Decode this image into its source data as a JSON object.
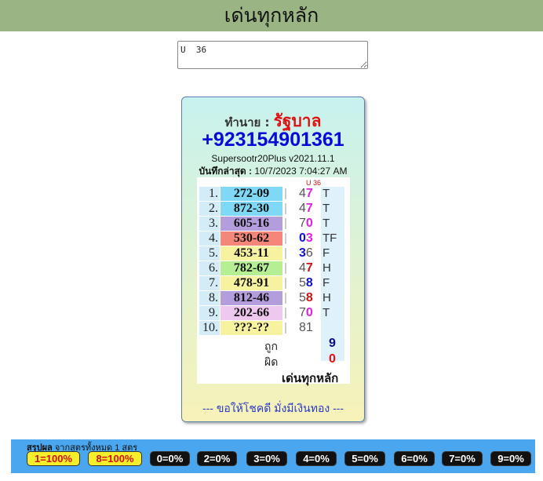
{
  "header": {
    "title": "เด่นทุกหลัก"
  },
  "input": {
    "value": "U  36"
  },
  "card": {
    "owner_label": "ทำนาย :",
    "owner_name": "รัฐบาล",
    "phone": "+923154901361",
    "version": "Supersootr20Plus v2021.11.1",
    "saved_label": "บันทึกล่าสุด :",
    "saved_value": "10/7/2023 7:04:27 AM",
    "column_header": "U 36",
    "rows": [
      {
        "num": "1.",
        "code": "272-09",
        "r1": "4",
        "r2": "7",
        "flag": "T",
        "code_bg": "#7fd8f6",
        "r1_color": "#555555",
        "r2_color": "#e020e0"
      },
      {
        "num": "2.",
        "code": "872-30",
        "r1": "4",
        "r2": "7",
        "flag": "T",
        "code_bg": "#7fd8f6",
        "r1_color": "#555555",
        "r2_color": "#e020e0"
      },
      {
        "num": "3.",
        "code": "605-16",
        "r1": "7",
        "r2": "0",
        "flag": "T",
        "code_bg": "#b39ddc",
        "r1_color": "#555555",
        "r2_color": "#e020e0"
      },
      {
        "num": "4.",
        "code": "530-62",
        "r1": "0",
        "r2": "3",
        "flag": "TF",
        "code_bg": "#f4877a",
        "r1_color": "#1010d0",
        "r2_color": "#e020e0"
      },
      {
        "num": "5.",
        "code": "453-11",
        "r1": "3",
        "r2": "6",
        "flag": "F",
        "code_bg": "#f7f2a0",
        "r1_color": "#1010d0",
        "r2_color": "#555555"
      },
      {
        "num": "6.",
        "code": "782-67",
        "r1": "4",
        "r2": "7",
        "flag": "H",
        "code_bg": "#b6ee94",
        "r1_color": "#555555",
        "r2_color": "#d01010"
      },
      {
        "num": "7.",
        "code": "478-91",
        "r1": "5",
        "r2": "8",
        "flag": "F",
        "code_bg": "#f7f2a0",
        "r1_color": "#555555",
        "r2_color": "#1010d0"
      },
      {
        "num": "8.",
        "code": "812-46",
        "r1": "5",
        "r2": "8",
        "flag": "H",
        "code_bg": "#b39ddc",
        "r1_color": "#555555",
        "r2_color": "#d01010"
      },
      {
        "num": "9.",
        "code": "202-66",
        "r1": "7",
        "r2": "0",
        "flag": "T",
        "code_bg": "#eec8ee",
        "r1_color": "#555555",
        "r2_color": "#e020e0"
      },
      {
        "num": "10.",
        "code": "???-??",
        "r1": "8",
        "r2": "1",
        "flag": "",
        "code_bg": "#f7f2a0",
        "r1_color": "#555555",
        "r2_color": "#555555"
      }
    ],
    "correct_label": "ถูก",
    "correct_value": "9",
    "wrong_label": "ผิด",
    "wrong_value": "0",
    "mode_label": "เด่นทุกหลัก",
    "blessing": "--- ขอให้โชคดี มั่งมีเงินทอง ---"
  },
  "footer": {
    "summary_label": "สรุปผล",
    "summary_text": "จากสูตรทั้งหมด 1 สูตร",
    "badges": [
      {
        "text": "1=100%",
        "state": "hit"
      },
      {
        "text": "8=100%",
        "state": "hit"
      },
      {
        "text": "0=0%",
        "state": "miss"
      },
      {
        "text": "2=0%",
        "state": "miss"
      },
      {
        "text": "3=0%",
        "state": "miss"
      },
      {
        "text": "4=0%",
        "state": "miss"
      },
      {
        "text": "5=0%",
        "state": "miss"
      },
      {
        "text": "6=0%",
        "state": "miss"
      },
      {
        "text": "7=0%",
        "state": "miss"
      },
      {
        "text": "9=0%",
        "state": "miss"
      }
    ]
  },
  "colors": {
    "header_bg": "#9ab484",
    "accent_red": "#e01010",
    "accent_blue": "#0a0ad8",
    "correct": "#0a0a8a",
    "wrong": "#e01010",
    "footer_bg": "#4aa6ee"
  }
}
